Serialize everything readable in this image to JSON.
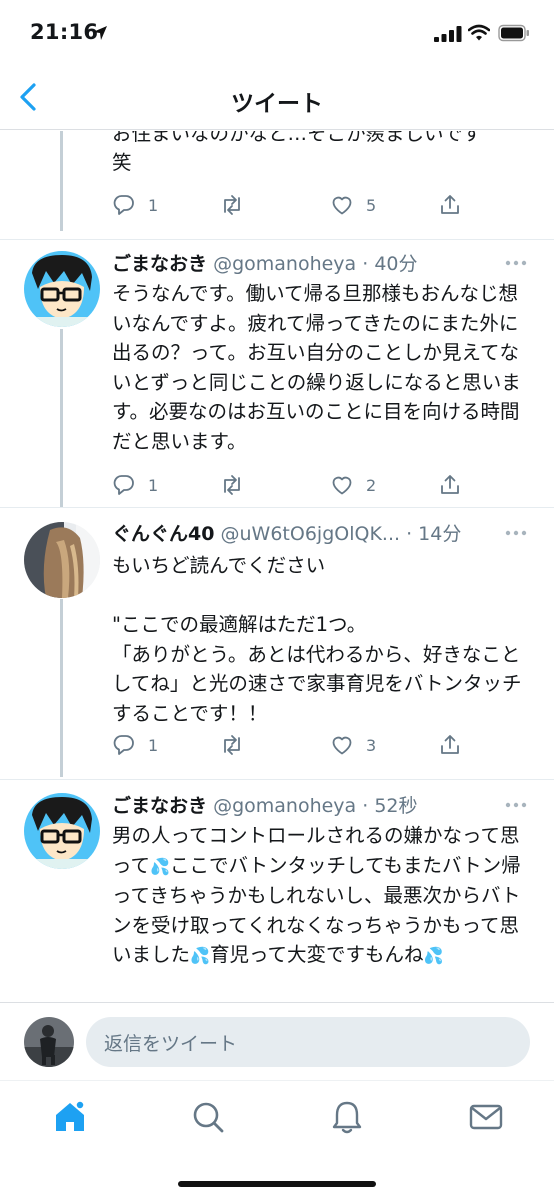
{
  "status": {
    "time": "21:16"
  },
  "nav": {
    "title": "ツイート"
  },
  "top_tweet": {
    "text_lines": [
      "お住まいなのかなと…そこか羨ましいです",
      "笑"
    ],
    "reply_count": "1",
    "retweet_count": "",
    "like_count": "5"
  },
  "tweets": [
    {
      "author": "ごまなおき",
      "handle": "@gomanoheya",
      "time": "· 40分",
      "text": "そうなんです。働いて帰る旦那様もおんなじ想いなんですよ。疲れて帰ってきたのにまた外に出るの？って。お互い自分のことしか見えてないとずっと同じことの繰り返しになると思います。必要なのはお互いのことに目を向ける時間だと思います。",
      "reply_count": "1",
      "like_count": "2"
    },
    {
      "author": "ぐんぐん40",
      "handle": "@uW6tO6jgOlQK...",
      "time": "· 14分",
      "text": "もいちど読んでください\n\n\"ここでの最適解はただ1つ。\n「ありがとう。あとは代わるから、好きなことしてね」と光の速さで家事育児をバトンタッチすることです！！",
      "reply_count": "1",
      "like_count": "3"
    },
    {
      "author": "ごまなおき",
      "handle": "@gomanoheya",
      "time": "· 52秒",
      "text_parts": [
        "男の人ってコントロールされるの嫌かなって思って",
        "ここでバトンタッチしてもまたバトン帰ってきちゃうかもしれないし、最悪次からバトンを受け取ってくれなくなっちゃうかもって思いました",
        "育児って大変ですもんね",
        ""
      ]
    }
  ],
  "reply_bar": {
    "placeholder": "返信をツイート"
  },
  "tabs": [
    "home-icon",
    "search-icon",
    "notifications-icon",
    "messages-icon"
  ],
  "colors": {
    "accent": "#1da1f2",
    "secondary_text": "#657786",
    "thread_line": "#c4cfd6"
  }
}
